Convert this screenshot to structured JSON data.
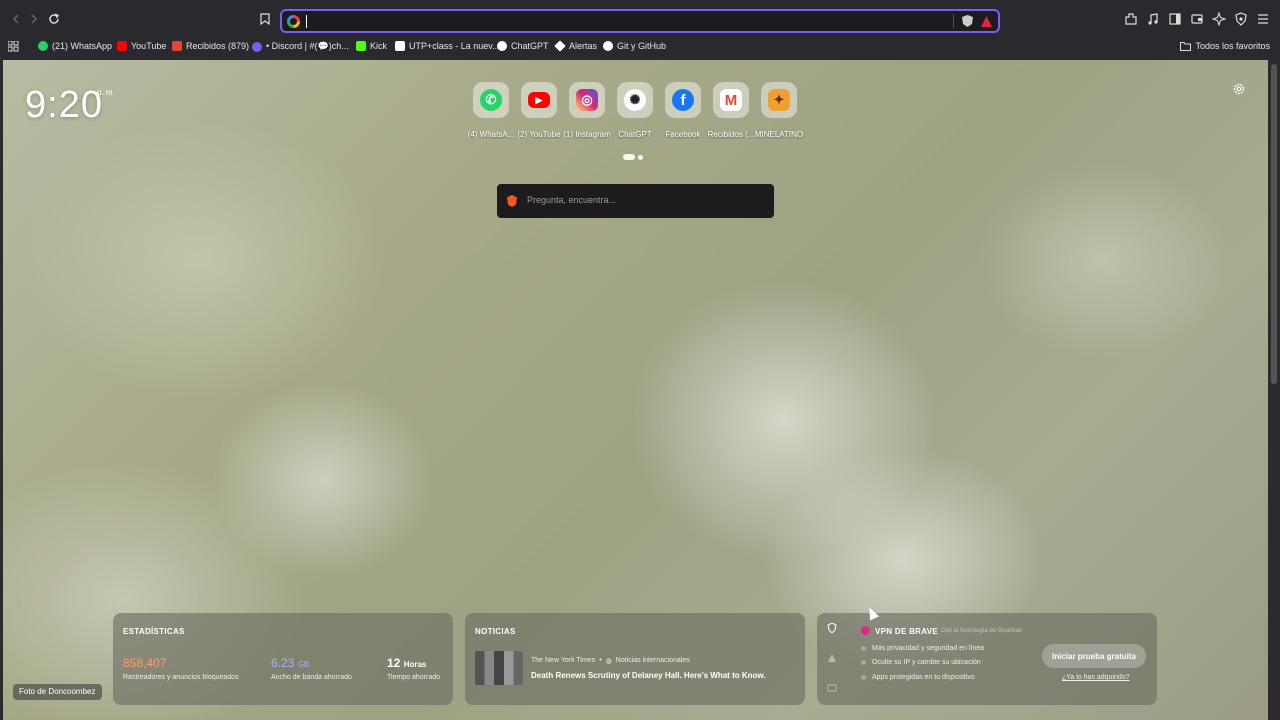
{
  "address": {
    "placeholder": ""
  },
  "bookmarks": [
    {
      "label": "(21) WhatsApp",
      "icon": "whatsapp-icon",
      "color": "#25d366"
    },
    {
      "label": "YouTube",
      "icon": "youtube-icon",
      "color": "#ff0000"
    },
    {
      "label": "Recibidos (879)",
      "icon": "gmail-icon",
      "color": "#ea4335"
    },
    {
      "label": "• Discord | #(💬)ch...",
      "icon": "discord-icon",
      "color": "#7b5cf5"
    },
    {
      "label": "Kick",
      "icon": "kick-icon",
      "color": "#53fc18"
    },
    {
      "label": "UTP+class - La nuev...",
      "icon": "utp-icon",
      "color": "#ffffff"
    },
    {
      "label": "ChatGPT",
      "icon": "chatgpt-icon",
      "color": "#ffffff"
    },
    {
      "label": "Alertas",
      "icon": "diamond-icon",
      "color": "#ffffff"
    },
    {
      "label": "Git y GitHub",
      "icon": "github-icon",
      "color": "#ffffff"
    }
  ],
  "favorites_label": "Todos los favoritos",
  "clock": {
    "time": "9:20",
    "ampm": "p. m."
  },
  "tiles": [
    {
      "label": "(4) WhatsA...",
      "icon": "whatsapp-icon",
      "color": "#25d366",
      "glyph": "✆"
    },
    {
      "label": "(2) YouTube",
      "icon": "youtube-icon",
      "color": "#ff0000",
      "glyph": "▶"
    },
    {
      "label": "(1) Instagram",
      "icon": "instagram-icon",
      "color": "#d62976",
      "glyph": "◎"
    },
    {
      "label": "ChatGPT",
      "icon": "chatgpt-icon",
      "color": "#ffffff",
      "glyph": "✺"
    },
    {
      "label": "Facebook",
      "icon": "facebook-icon",
      "color": "#1877f2",
      "glyph": "f"
    },
    {
      "label": "Recibidos (...",
      "icon": "gmail-icon",
      "color": "#ffffff",
      "glyph": "M"
    },
    {
      "label": "MINELATINO",
      "icon": "minelatino-icon",
      "color": "#f0a030",
      "glyph": "✦"
    }
  ],
  "search": {
    "placeholder": "Pregunta, encuentra..."
  },
  "photo_credit": "Foto de Doncoombez",
  "stats": {
    "title": "ESTADÍSTICAS",
    "trackers": {
      "value": "858,407",
      "label": "Rastreadores y anuncios bloqueados",
      "color": "#ff9a6a"
    },
    "bandwidth": {
      "value": "6.23",
      "unit": "GB",
      "label": "Ancho de banda ahorrado",
      "color": "#a4b4ff"
    },
    "time": {
      "value": "12",
      "unit": "Horas",
      "label": "Tiempo ahorrado"
    }
  },
  "news": {
    "title": "NOTICIAS",
    "source": "The New York Times",
    "category": "Noticias internacionales",
    "headline": "Death Renews Scrutiny of Delaney Hall. Here's What to Know."
  },
  "vpn": {
    "title": "VPN DE BRAVE",
    "powered": "Con la tecnología de Guardian",
    "features": [
      "Más privacidad y seguridad en línea",
      "Oculte su IP y cambie su ubicación",
      "Apps protegidas en tu dispositivo"
    ],
    "button": "Iniciar prueba gratuita",
    "link": "¿Ya lo has adquirido?"
  }
}
